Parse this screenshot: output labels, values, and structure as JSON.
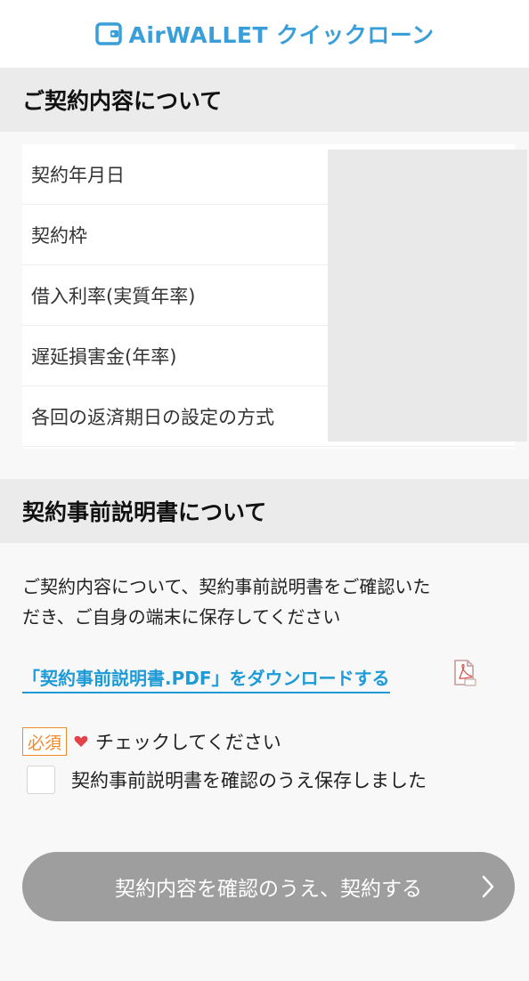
{
  "header": {
    "logo_text": "AirWALLET クイックローン",
    "brand_color": "#3a9fd8"
  },
  "contract_section": {
    "title": "ご契約内容について",
    "rows": [
      {
        "label": "契約年月日"
      },
      {
        "label": "契約枠"
      },
      {
        "label": "借入利率(実質年率)"
      },
      {
        "label": "遅延損害金(年率)"
      },
      {
        "label": "各回の返済期日の設定の方式"
      }
    ]
  },
  "explanation_section": {
    "title": "契約事前説明書について",
    "description_lines": [
      "ご契約内容について、契約事前説明書をご確認いた",
      "だき、ご自身の端末に保存してください"
    ],
    "download_link": "「契約事前説明書.PDF」をダウンロードする",
    "link_color": "#1e9bd7",
    "pdf_icon": "pdf-file-icon"
  },
  "confirmation": {
    "required_badge": "必須",
    "required_color": "#f08a2e",
    "heart_icon": "heart-icon",
    "prompt": "チェックしてください",
    "checkbox_label": "契約事前説明書を確認のうえ保存しました",
    "checked": false
  },
  "submit": {
    "label": "契約内容を確認のうえ、契約する",
    "icon": "chevron-right-icon",
    "disabled_color": "#9e9e9e"
  }
}
